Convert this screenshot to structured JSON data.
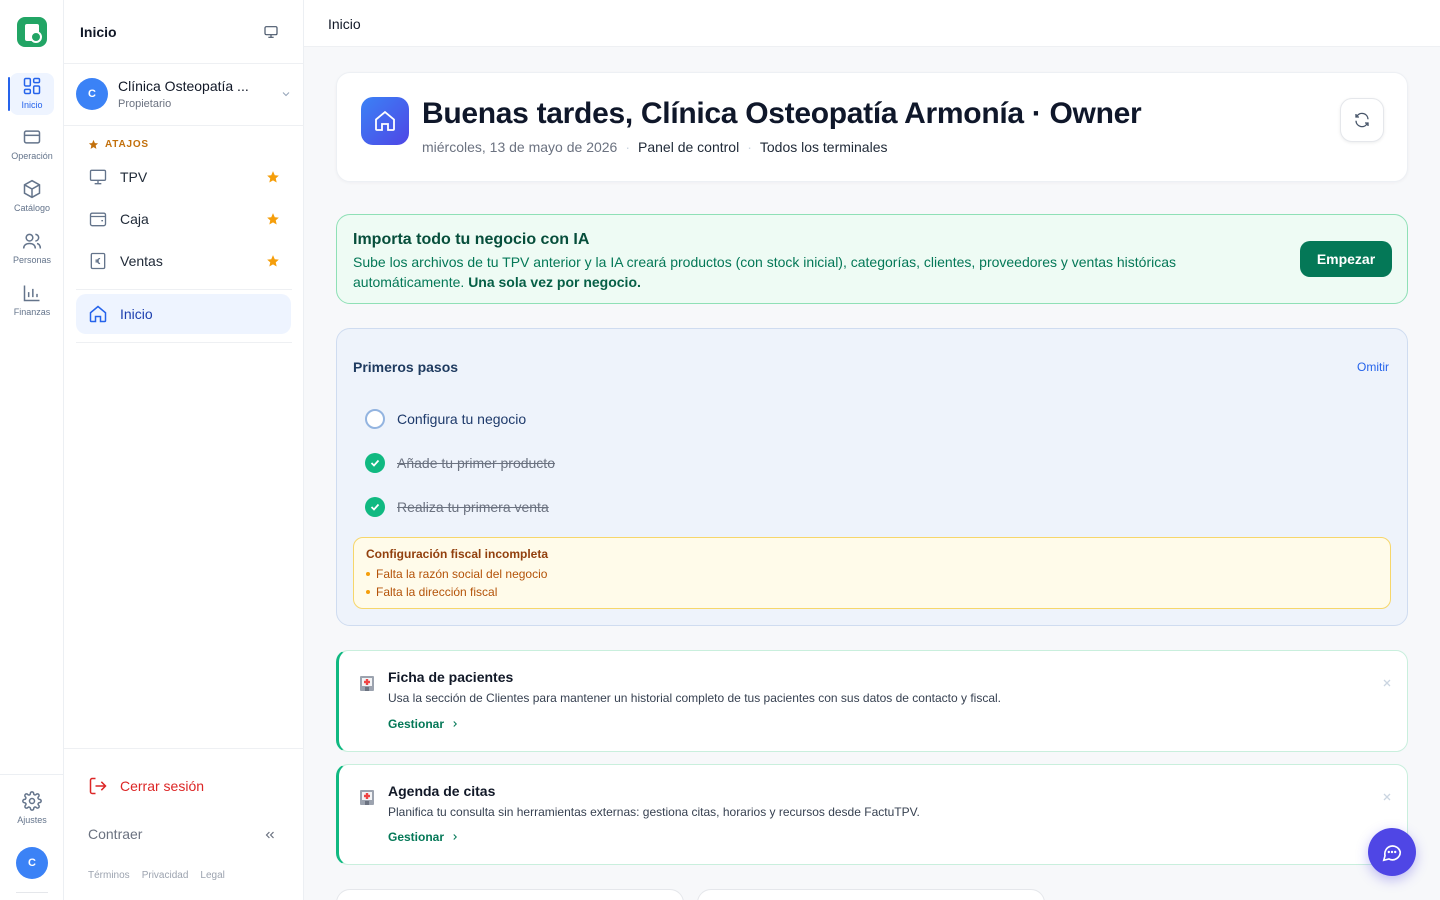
{
  "rail": {
    "items": [
      {
        "label": "Inicio",
        "icon": "grid-icon"
      },
      {
        "label": "Operación",
        "icon": "credit-card-icon"
      },
      {
        "label": "Catálogo",
        "icon": "box-icon"
      },
      {
        "label": "Personas",
        "icon": "users-icon"
      },
      {
        "label": "Finanzas",
        "icon": "bar-chart-icon"
      }
    ],
    "settings_label": "Ajustes",
    "avatar_initial": "C"
  },
  "sidebar": {
    "title": "Inicio",
    "org": {
      "initial": "C",
      "name": "Clínica Osteopatía ...",
      "role": "Propietario"
    },
    "shortcuts_heading": "ATAJOS",
    "shortcuts": [
      {
        "label": "TPV",
        "icon": "monitor-icon"
      },
      {
        "label": "Caja",
        "icon": "wallet-icon"
      },
      {
        "label": "Ventas",
        "icon": "receipt-euro-icon"
      }
    ],
    "active_nav": "Inicio",
    "logout_label": "Cerrar sesión",
    "collapse_label": "Contraer",
    "footer_links": [
      "Términos",
      "Privacidad",
      "Legal"
    ]
  },
  "topbar": {
    "title": "Inicio"
  },
  "hero": {
    "title": "Buenas tardes, Clínica Osteopatía Armonía · Owner",
    "date": "miércoles, 13 de mayo de 2026",
    "context": "Panel de control",
    "scope": "Todos los terminales"
  },
  "import_banner": {
    "title": "Importa todo tu negocio con IA",
    "description": "Sube los archivos de tu TPV anterior y la IA creará productos (con stock inicial), categorías, clientes, proveedores y ventas históricas automáticamente.",
    "emphasis": "Una sola vez por negocio.",
    "button": "Empezar"
  },
  "onboarding": {
    "title": "Primeros pasos",
    "skip": "Omitir",
    "steps": [
      {
        "label": "Configura tu negocio",
        "done": false
      },
      {
        "label": "Añade tu primer producto",
        "done": true
      },
      {
        "label": "Realiza tu primera venta",
        "done": true
      }
    ],
    "fiscal_warning": {
      "title": "Configuración fiscal incompleta",
      "items": [
        "Falta la razón social del negocio",
        "Falta la dirección fiscal"
      ]
    }
  },
  "cards": [
    {
      "title": "Ficha de pacientes",
      "description": "Usa la sección de Clientes para mantener un historial completo de tus pacientes con sus datos de contacto y fiscal.",
      "link": "Gestionar",
      "icon": "hospital-icon"
    },
    {
      "title": "Agenda de citas",
      "description": "Planifica tu consulta sin herramientas externas: gestiona citas, horarios y recursos desde FactuTPV.",
      "link": "Gestionar",
      "icon": "hospital-icon"
    }
  ],
  "colors": {
    "primary": "#2563eb",
    "success": "#047857",
    "warning": "#f59e0b",
    "danger": "#dc2626",
    "chat": "#4f46e5"
  }
}
